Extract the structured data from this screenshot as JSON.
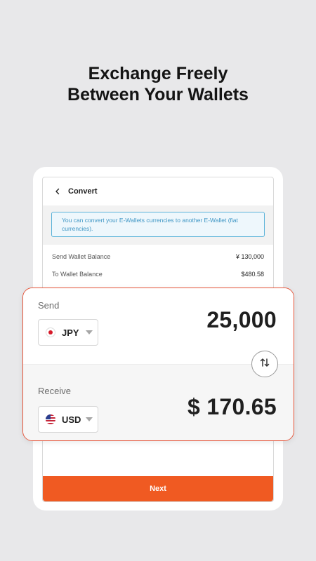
{
  "headline": {
    "line1": "Exchange Freely",
    "line2": "Between Your Wallets"
  },
  "header": {
    "title": "Convert"
  },
  "info_banner": {
    "text": "You can convert your E-Wallets currencies to another E-Wallet (fiat currencies)."
  },
  "balances": [
    {
      "label": "Send Wallet Balance",
      "value": "¥ 130,000"
    },
    {
      "label": "To Wallet Balance",
      "value": "$480.58"
    }
  ],
  "send": {
    "label": "Send",
    "currency": "JPY",
    "amount": "25,000"
  },
  "receive": {
    "label": "Receive",
    "currency": "USD",
    "amount": "$ 170.65"
  },
  "next_button": {
    "label": "Next"
  },
  "colors": {
    "accent": "#f05a22",
    "card_border": "#e6553a",
    "info_border": "#5bb3d9",
    "info_text": "#3d95c4"
  },
  "icons": {
    "back": "chevron-left-icon",
    "swap": "swap-arrows-icon",
    "dropdown": "caret-down-icon"
  }
}
